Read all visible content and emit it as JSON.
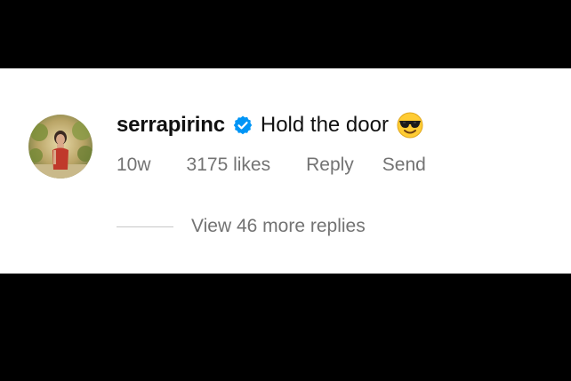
{
  "comment": {
    "username": "serrapirinc",
    "text": "Hold the door",
    "emoji": "sunglasses-face-emoji",
    "time": "10w",
    "likes": "3175 likes",
    "reply_label": "Reply",
    "send_label": "Send",
    "view_replies_label": "View 46 more replies"
  },
  "colors": {
    "background_band": "#000000",
    "card": "#ffffff",
    "text_primary": "#111111",
    "text_secondary": "#737373",
    "verified_badge": "#0095f6",
    "divider": "#c7c7c7"
  }
}
